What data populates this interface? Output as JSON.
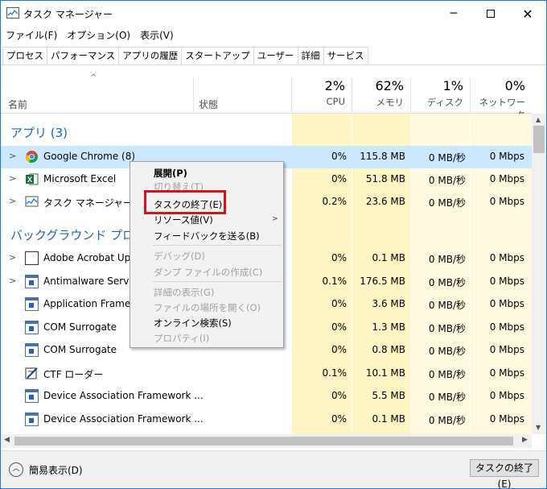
{
  "window": {
    "title": "タスク マネージャー",
    "min_icon": "minimize-icon",
    "max_icon": "maximize-icon",
    "close_icon": "close-icon"
  },
  "menu": [
    "ファイル(F)",
    "オプション(O)",
    "表示(V)"
  ],
  "tabs": [
    "プロセス",
    "パフォーマンス",
    "アプリの履歴",
    "スタートアップ",
    "ユーザー",
    "詳細",
    "サービス"
  ],
  "header": {
    "name": "名前",
    "status": "状態",
    "cpu_pct": "2%",
    "cpu_label": "CPU",
    "mem_pct": "62%",
    "mem_label": "メモリ",
    "disk_pct": "1%",
    "disk_label": "ディスク",
    "net_pct": "0%",
    "net_label": "ネットワーク"
  },
  "groups": {
    "apps": "アプリ (3)",
    "background": "バックグラウンド プロセス"
  },
  "rows": [
    {
      "name": "Google Chrome (8)",
      "cpu": "0%",
      "mem": "115.8 MB",
      "disk": "0 MB/秒",
      "net": "0 Mbps"
    },
    {
      "name": "Microsoft Excel",
      "cpu": "0%",
      "mem": "51.8 MB",
      "disk": "0 MB/秒",
      "net": "0 Mbps"
    },
    {
      "name": "タスク マネージャー",
      "cpu": "0.2%",
      "mem": "23.6 MB",
      "disk": "0 MB/秒",
      "net": "0 Mbps"
    },
    {
      "name": "Adobe Acrobat Update",
      "cpu": "0%",
      "mem": "0.1 MB",
      "disk": "0 MB/秒",
      "net": "0 Mbps"
    },
    {
      "name": "Antimalware Service",
      "cpu": "0.1%",
      "mem": "176.5 MB",
      "disk": "0 MB/秒",
      "net": "0 Mbps"
    },
    {
      "name": "Application Frame H",
      "cpu": "0%",
      "mem": "3.6 MB",
      "disk": "0 MB/秒",
      "net": "0 Mbps"
    },
    {
      "name": "COM Surrogate",
      "cpu": "0%",
      "mem": "1.3 MB",
      "disk": "0 MB/秒",
      "net": "0 Mbps"
    },
    {
      "name": "COM Surrogate",
      "cpu": "0%",
      "mem": "0.8 MB",
      "disk": "0 MB/秒",
      "net": "0 Mbps"
    },
    {
      "name": "CTF ローダー",
      "cpu": "0.1%",
      "mem": "10.1 MB",
      "disk": "0 MB/秒",
      "net": "0 Mbps"
    },
    {
      "name": "Device Association Framework ...",
      "cpu": "0%",
      "mem": "5.5 MB",
      "disk": "0 MB/秒",
      "net": "0 Mbps"
    },
    {
      "name": "Device Association Framework ...",
      "cpu": "0%",
      "mem": "0.1 MB",
      "disk": "0 MB/秒",
      "net": "0 Mbps"
    }
  ],
  "context_menu": {
    "expand": "展開(P)",
    "switch_to": "切り替え(T)",
    "end_task": "タスクの終了(E)",
    "resource_values": "リソース値(V)",
    "feedback": "フィードバックを送る(B)",
    "debug": "デバッグ(D)",
    "dump": "ダンプ ファイルの作成(C)",
    "details": "詳細の表示(G)",
    "open_location": "ファイルの場所を開く(O)",
    "search_online": "オンライン検索(S)",
    "properties": "プロパティ(I)"
  },
  "footer": {
    "fewer_details": "簡易表示(D)",
    "end_task_button": "タスクの終了(E)"
  },
  "colors": {
    "accent": "#1e63b8",
    "selected_row": "#cce8ff",
    "cell_light": "#fff9e0",
    "cell_mid": "#fff4c4",
    "highlight": "#d0161b"
  }
}
